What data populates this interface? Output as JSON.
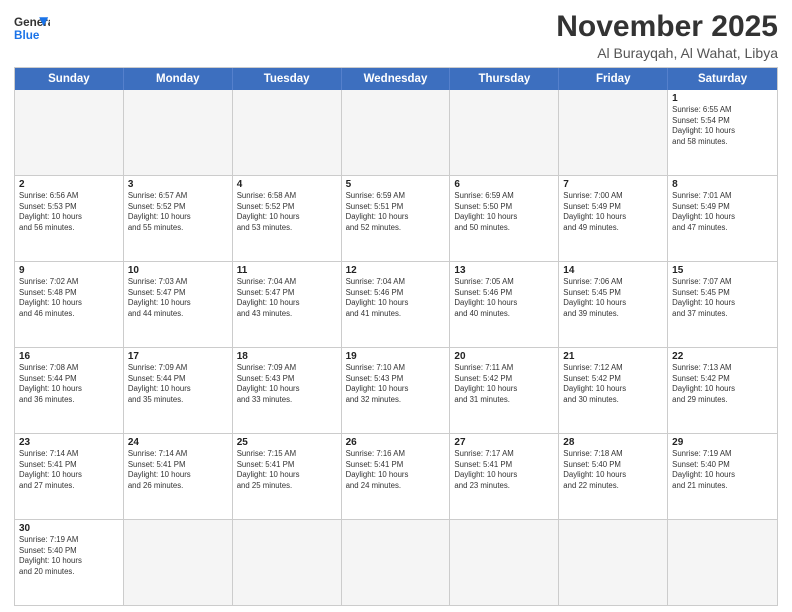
{
  "logo": {
    "general": "General",
    "blue": "Blue"
  },
  "header": {
    "month": "November 2025",
    "location": "Al Burayqah, Al Wahat, Libya"
  },
  "weekdays": [
    "Sunday",
    "Monday",
    "Tuesday",
    "Wednesday",
    "Thursday",
    "Friday",
    "Saturday"
  ],
  "rows": [
    [
      {
        "day": "",
        "info": ""
      },
      {
        "day": "",
        "info": ""
      },
      {
        "day": "",
        "info": ""
      },
      {
        "day": "",
        "info": ""
      },
      {
        "day": "",
        "info": ""
      },
      {
        "day": "",
        "info": ""
      },
      {
        "day": "1",
        "info": "Sunrise: 6:55 AM\nSunset: 5:54 PM\nDaylight: 10 hours\nand 58 minutes."
      }
    ],
    [
      {
        "day": "2",
        "info": "Sunrise: 6:56 AM\nSunset: 5:53 PM\nDaylight: 10 hours\nand 56 minutes."
      },
      {
        "day": "3",
        "info": "Sunrise: 6:57 AM\nSunset: 5:52 PM\nDaylight: 10 hours\nand 55 minutes."
      },
      {
        "day": "4",
        "info": "Sunrise: 6:58 AM\nSunset: 5:52 PM\nDaylight: 10 hours\nand 53 minutes."
      },
      {
        "day": "5",
        "info": "Sunrise: 6:59 AM\nSunset: 5:51 PM\nDaylight: 10 hours\nand 52 minutes."
      },
      {
        "day": "6",
        "info": "Sunrise: 6:59 AM\nSunset: 5:50 PM\nDaylight: 10 hours\nand 50 minutes."
      },
      {
        "day": "7",
        "info": "Sunrise: 7:00 AM\nSunset: 5:49 PM\nDaylight: 10 hours\nand 49 minutes."
      },
      {
        "day": "8",
        "info": "Sunrise: 7:01 AM\nSunset: 5:49 PM\nDaylight: 10 hours\nand 47 minutes."
      }
    ],
    [
      {
        "day": "9",
        "info": "Sunrise: 7:02 AM\nSunset: 5:48 PM\nDaylight: 10 hours\nand 46 minutes."
      },
      {
        "day": "10",
        "info": "Sunrise: 7:03 AM\nSunset: 5:47 PM\nDaylight: 10 hours\nand 44 minutes."
      },
      {
        "day": "11",
        "info": "Sunrise: 7:04 AM\nSunset: 5:47 PM\nDaylight: 10 hours\nand 43 minutes."
      },
      {
        "day": "12",
        "info": "Sunrise: 7:04 AM\nSunset: 5:46 PM\nDaylight: 10 hours\nand 41 minutes."
      },
      {
        "day": "13",
        "info": "Sunrise: 7:05 AM\nSunset: 5:46 PM\nDaylight: 10 hours\nand 40 minutes."
      },
      {
        "day": "14",
        "info": "Sunrise: 7:06 AM\nSunset: 5:45 PM\nDaylight: 10 hours\nand 39 minutes."
      },
      {
        "day": "15",
        "info": "Sunrise: 7:07 AM\nSunset: 5:45 PM\nDaylight: 10 hours\nand 37 minutes."
      }
    ],
    [
      {
        "day": "16",
        "info": "Sunrise: 7:08 AM\nSunset: 5:44 PM\nDaylight: 10 hours\nand 36 minutes."
      },
      {
        "day": "17",
        "info": "Sunrise: 7:09 AM\nSunset: 5:44 PM\nDaylight: 10 hours\nand 35 minutes."
      },
      {
        "day": "18",
        "info": "Sunrise: 7:09 AM\nSunset: 5:43 PM\nDaylight: 10 hours\nand 33 minutes."
      },
      {
        "day": "19",
        "info": "Sunrise: 7:10 AM\nSunset: 5:43 PM\nDaylight: 10 hours\nand 32 minutes."
      },
      {
        "day": "20",
        "info": "Sunrise: 7:11 AM\nSunset: 5:42 PM\nDaylight: 10 hours\nand 31 minutes."
      },
      {
        "day": "21",
        "info": "Sunrise: 7:12 AM\nSunset: 5:42 PM\nDaylight: 10 hours\nand 30 minutes."
      },
      {
        "day": "22",
        "info": "Sunrise: 7:13 AM\nSunset: 5:42 PM\nDaylight: 10 hours\nand 29 minutes."
      }
    ],
    [
      {
        "day": "23",
        "info": "Sunrise: 7:14 AM\nSunset: 5:41 PM\nDaylight: 10 hours\nand 27 minutes."
      },
      {
        "day": "24",
        "info": "Sunrise: 7:14 AM\nSunset: 5:41 PM\nDaylight: 10 hours\nand 26 minutes."
      },
      {
        "day": "25",
        "info": "Sunrise: 7:15 AM\nSunset: 5:41 PM\nDaylight: 10 hours\nand 25 minutes."
      },
      {
        "day": "26",
        "info": "Sunrise: 7:16 AM\nSunset: 5:41 PM\nDaylight: 10 hours\nand 24 minutes."
      },
      {
        "day": "27",
        "info": "Sunrise: 7:17 AM\nSunset: 5:41 PM\nDaylight: 10 hours\nand 23 minutes."
      },
      {
        "day": "28",
        "info": "Sunrise: 7:18 AM\nSunset: 5:40 PM\nDaylight: 10 hours\nand 22 minutes."
      },
      {
        "day": "29",
        "info": "Sunrise: 7:19 AM\nSunset: 5:40 PM\nDaylight: 10 hours\nand 21 minutes."
      }
    ],
    [
      {
        "day": "30",
        "info": "Sunrise: 7:19 AM\nSunset: 5:40 PM\nDaylight: 10 hours\nand 20 minutes."
      },
      {
        "day": "",
        "info": ""
      },
      {
        "day": "",
        "info": ""
      },
      {
        "day": "",
        "info": ""
      },
      {
        "day": "",
        "info": ""
      },
      {
        "day": "",
        "info": ""
      },
      {
        "day": "",
        "info": ""
      }
    ]
  ]
}
